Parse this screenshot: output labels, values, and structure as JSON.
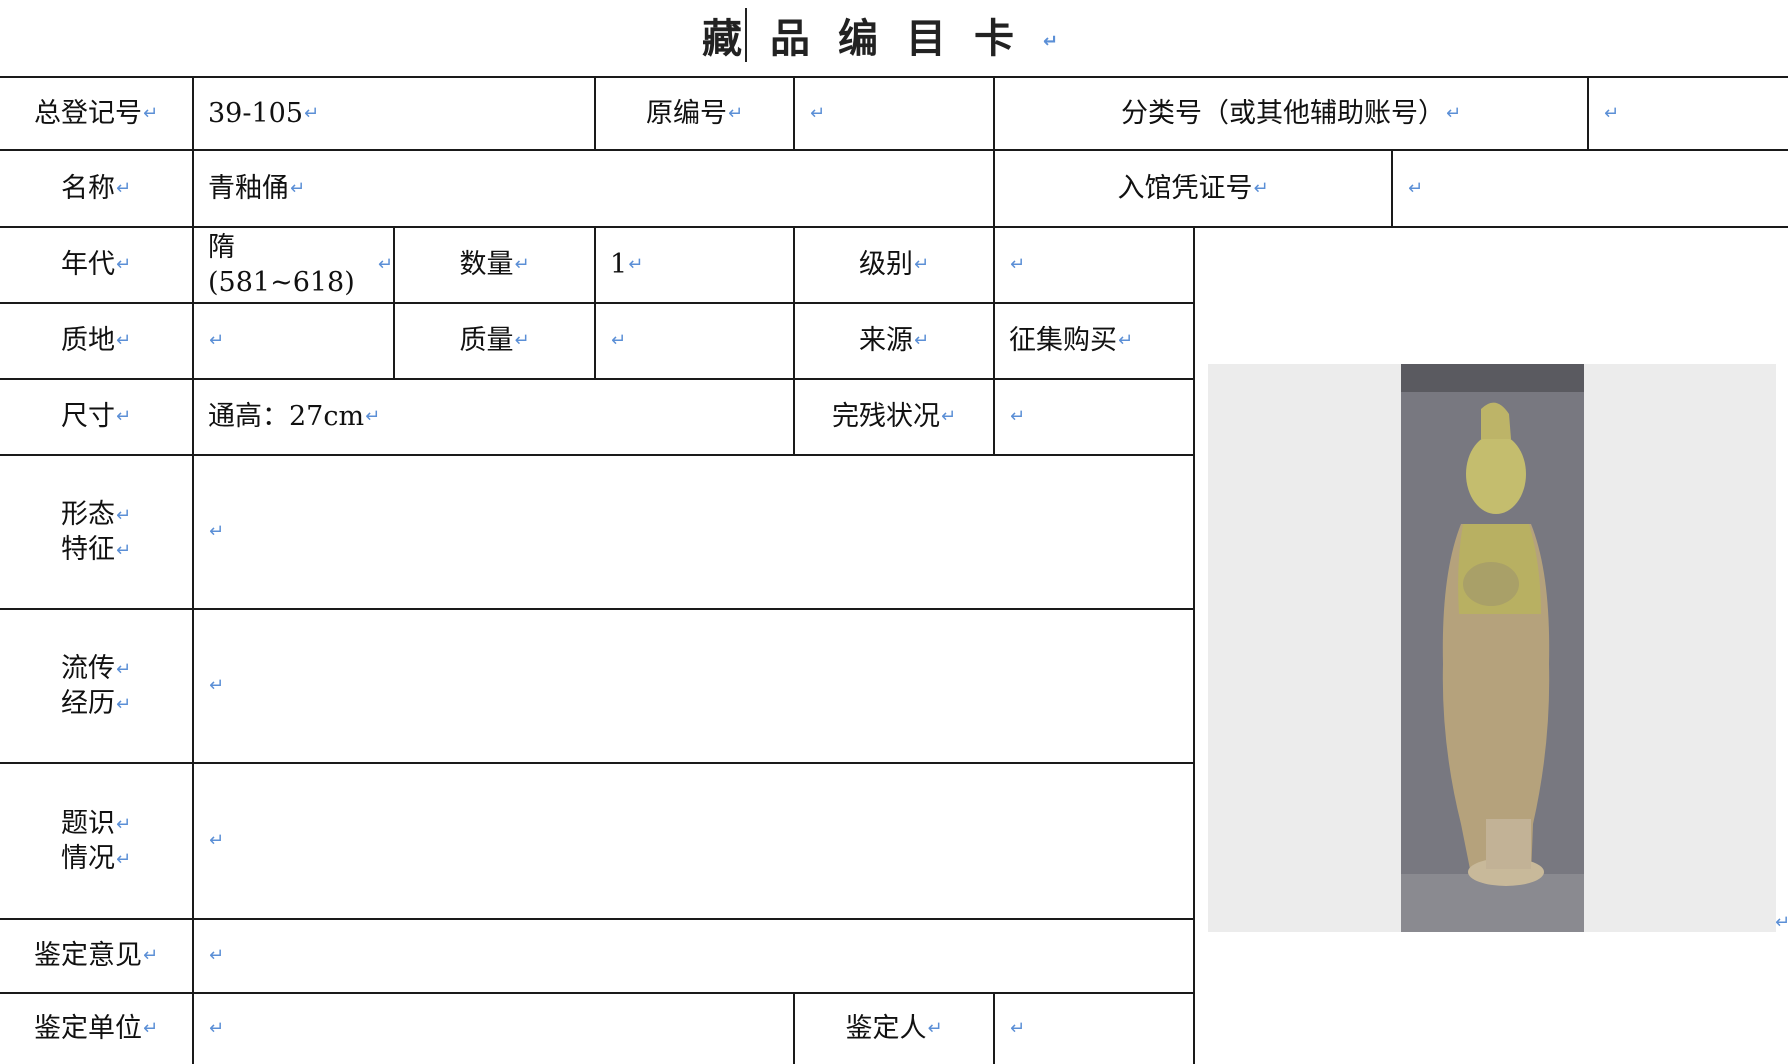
{
  "title": "藏品编目卡",
  "return_mark": "↵",
  "fields": {
    "zongdengjihao": {
      "label": "总登记号",
      "value": "39-105"
    },
    "yuanbianhao": {
      "label": "原编号",
      "value": ""
    },
    "fenleihao": {
      "label": "分类号（或其他辅助账号）",
      "value": ""
    },
    "mingcheng": {
      "label": "名称",
      "value": "青釉俑"
    },
    "ruguan": {
      "label": "入馆凭证号",
      "value": ""
    },
    "niandai": {
      "label": "年代",
      "value": "隋(581~618)"
    },
    "shuliang": {
      "label": "数量",
      "value": "1"
    },
    "jibie": {
      "label": "级别",
      "value": ""
    },
    "zhidi": {
      "label": "质地",
      "value": ""
    },
    "zhiliang": {
      "label": "质量",
      "value": ""
    },
    "laiyuan": {
      "label": "来源",
      "value": "征集购买"
    },
    "chicun": {
      "label": "尺寸",
      "value": "通高：27cm"
    },
    "wancan": {
      "label": "完残状况",
      "value": ""
    },
    "xingtai": {
      "label_line1": "形态",
      "label_line2": "特征",
      "value": ""
    },
    "liuchuan": {
      "label_line1": "流传",
      "label_line2": "经历",
      "value": ""
    },
    "tishi": {
      "label_line1": "题识",
      "label_line2": "情况",
      "value": ""
    },
    "jiandingyijian": {
      "label": "鉴定意见",
      "value": ""
    },
    "jiandingdanwei": {
      "label": "鉴定单位",
      "value": ""
    },
    "jiandingren": {
      "label": "鉴定人",
      "value": ""
    }
  },
  "colors": {
    "return_mark": "#5b8fd6",
    "grid": "#1a1a1a"
  }
}
